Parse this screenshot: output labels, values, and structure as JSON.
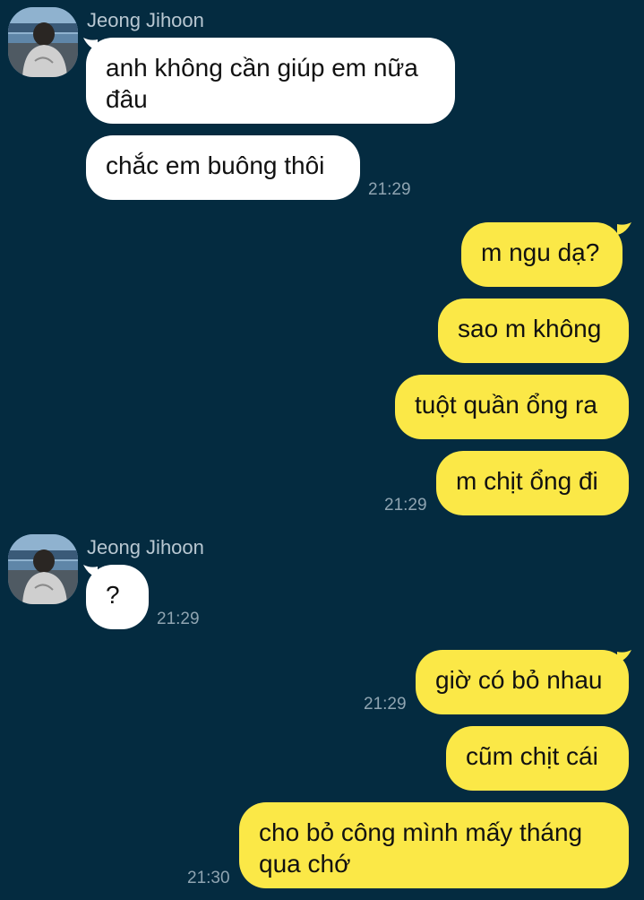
{
  "chat": {
    "sender_name": "Jeong Jihoon",
    "colors": {
      "background": "#042b40",
      "incoming_bubble": "#ffffff",
      "outgoing_bubble": "#fbe847",
      "timestamp": "#8fa4b1"
    },
    "group1": {
      "sender": "Jeong Jihoon",
      "messages": [
        "anh không cần giúp em nữa đâu",
        "chắc em buông thôi"
      ],
      "time": "21:29"
    },
    "group2": {
      "messages": [
        "m ngu dạ?",
        "sao m không",
        "tuột quần ổng ra",
        "m chịt ổng đi"
      ],
      "time": "21:29"
    },
    "group3": {
      "sender": "Jeong Jihoon",
      "messages": [
        "?"
      ],
      "time": "21:29"
    },
    "group4": {
      "messages": [
        "giờ có bỏ nhau"
      ],
      "time": "21:29"
    },
    "group5": {
      "messages": [
        "cũm chịt cái",
        "cho bỏ công mình mấy tháng qua chớ"
      ],
      "time": "21:30"
    }
  }
}
